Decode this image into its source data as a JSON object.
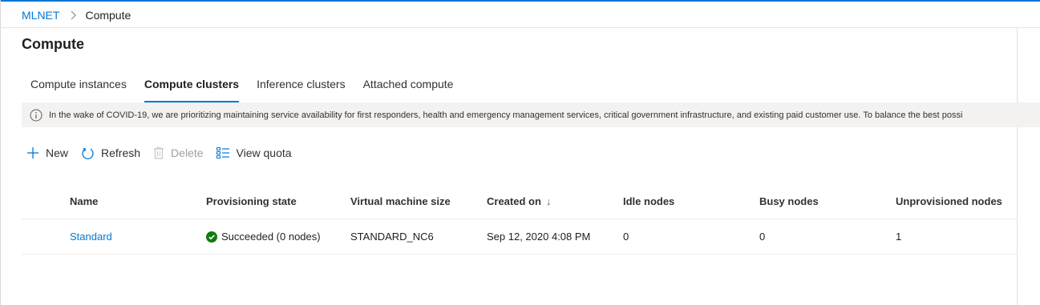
{
  "breadcrumb": {
    "workspace": "MLNET",
    "current": "Compute"
  },
  "page": {
    "title": "Compute"
  },
  "tabs": [
    {
      "label": "Compute instances",
      "selected": false
    },
    {
      "label": "Compute clusters",
      "selected": true
    },
    {
      "label": "Inference clusters",
      "selected": false
    },
    {
      "label": "Attached compute",
      "selected": false
    }
  ],
  "banner": {
    "icon": "info-icon",
    "text": "In the wake of COVID-19, we are prioritizing maintaining service availability for first responders, health and emergency management services, critical government infrastructure, and existing paid customer use. To balance the best possi"
  },
  "toolbar": {
    "new_label": "New",
    "refresh_label": "Refresh",
    "delete_label": "Delete",
    "quota_label": "View quota"
  },
  "table": {
    "columns": [
      "Name",
      "Provisioning state",
      "Virtual machine size",
      "Created on",
      "Idle nodes",
      "Busy nodes",
      "Unprovisioned nodes"
    ],
    "sort_indicator": "↓",
    "rows": [
      {
        "name": "Standard",
        "state": "Succeeded (0 nodes)",
        "vm_size": "STANDARD_NC6",
        "created": "Sep 12, 2020 4:08 PM",
        "idle": "0",
        "busy": "0",
        "unprovisioned": "1"
      }
    ]
  },
  "colors": {
    "accent": "#0078d4",
    "success": "#107c10",
    "banner_bg": "#f3f2f1"
  }
}
